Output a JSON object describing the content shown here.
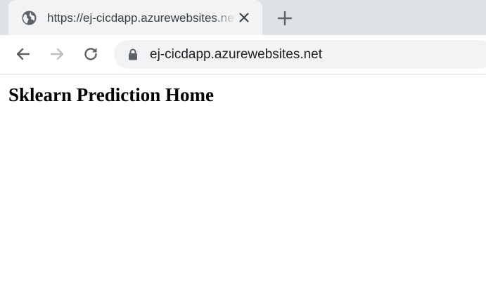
{
  "browser": {
    "tab": {
      "title": "https://ej-cicdapp.azurewebsites.net",
      "favicon": "globe-icon",
      "close_icon": "close-icon"
    },
    "new_tab_icon": "plus-icon",
    "toolbar": {
      "back_icon": "arrow-left-icon",
      "forward_icon": "arrow-right-icon",
      "forward_enabled": false,
      "reload_icon": "reload-icon",
      "security_icon": "lock-icon",
      "url": "ej-cicdapp.azurewebsites.net"
    },
    "colors": {
      "tabstrip": "#dee1e6",
      "active_tab": "#f1f3f4",
      "omnibox": "#f1f3f4",
      "icon": "#5f6368",
      "icon_disabled": "#bdc1c6"
    }
  },
  "page": {
    "heading": "Sklearn Prediction Home"
  }
}
